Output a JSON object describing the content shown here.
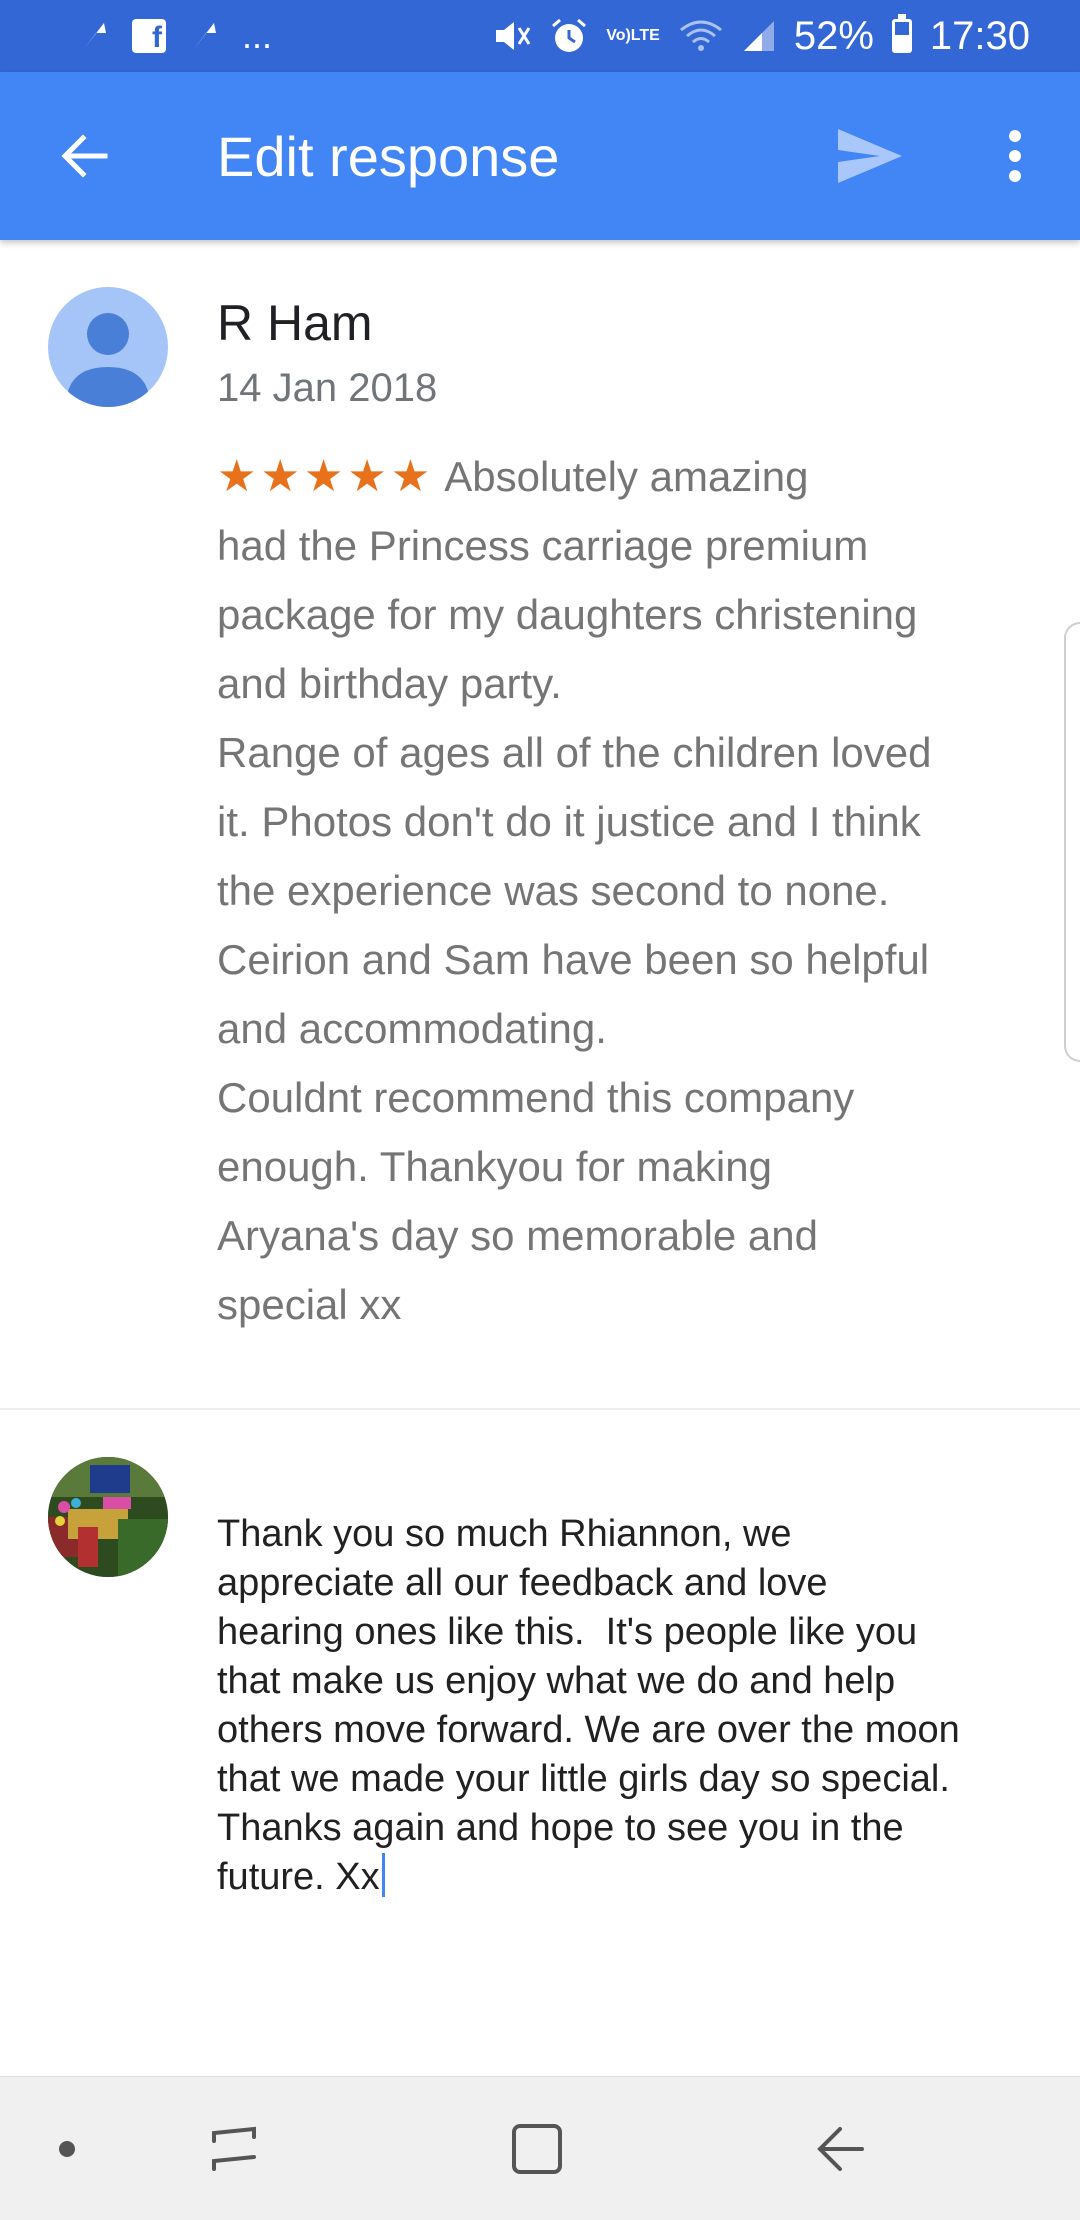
{
  "status_bar": {
    "battery_text": "52%",
    "battery_level": 0.52,
    "time": "17:30",
    "volte_line1": "Vo)",
    "volte_line2": "LTE",
    "overflow": "...",
    "icons": [
      "notification-arrow-icon",
      "facebook-icon",
      "notification-arrow-icon",
      "mute-icon",
      "alarm-icon",
      "volte-icon",
      "wifi-icon",
      "signal-icon",
      "battery-icon"
    ]
  },
  "app_bar": {
    "title": "Edit response",
    "icons": [
      "back-arrow-icon",
      "send-icon",
      "more-vert-icon"
    ]
  },
  "review": {
    "name": "R Ham",
    "date": "14 Jan 2018",
    "stars": "★★★★★",
    "rating": 5,
    "text_lines": [
      "Absolutely amazing",
      "had the Princess carriage premium",
      "package for my daughters christening",
      "and birthday party.",
      "Range of ages all of the children loved",
      "it. Photos don't do it justice and I think",
      "the experience was second to none.",
      "Ceirion and Sam have been so helpful",
      "and accommodating.",
      "Couldnt recommend this company",
      "enough. Thankyou for making",
      "Aryana's day so memorable and",
      "special xx"
    ]
  },
  "response": {
    "lines": [
      "Thank you so much Rhiannon, we",
      "appreciate all our feedback and love",
      "hearing ones like this.  It's people like you",
      "that make us enjoy what we do and help",
      "others move forward. We are over the moon",
      "that we made your little girls day so special.",
      "Thanks again and hope to see you in the",
      "future. Xx"
    ]
  },
  "nav_bar": {
    "icons": [
      "dot-icon",
      "recent-apps-icon",
      "home-icon",
      "back-icon"
    ]
  },
  "colors": {
    "status_bar": "#3367d6",
    "app_bar": "#4285f4",
    "star": "#e8711c",
    "review_text": "#757575",
    "caret": "#4285f4"
  }
}
